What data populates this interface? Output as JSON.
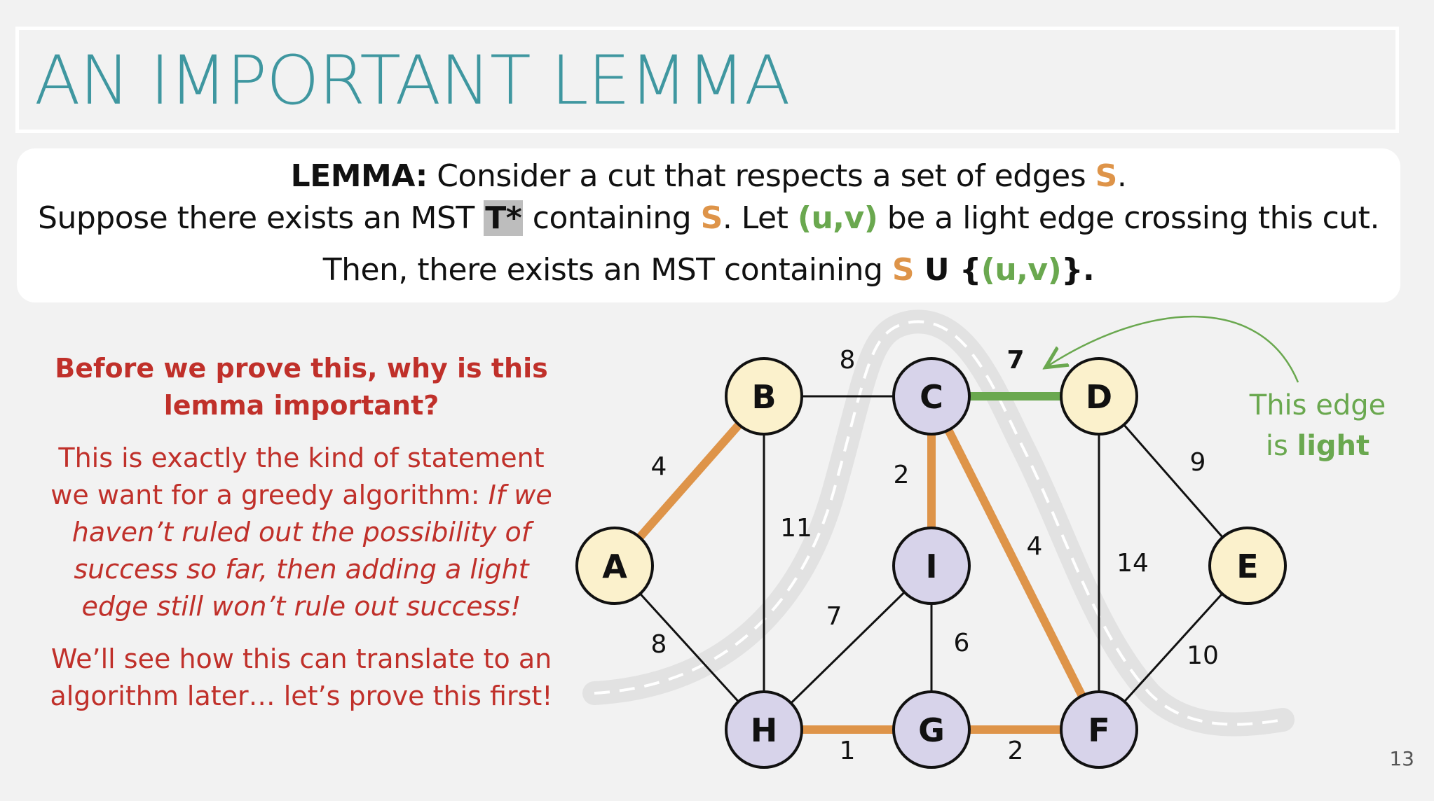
{
  "title": "AN IMPORTANT LEMMA",
  "lemma": {
    "label": "LEMMA:",
    "line1_text": " Consider a cut that respects a set of edges ",
    "S": "S",
    "period": ".",
    "line2_a": "Suppose there exists an MST ",
    "tstar": "T*",
    "line2_b": " containing ",
    "line2_c": ". Let ",
    "uv": "(u,v)",
    "line2_d": " be a light edge crossing this cut.",
    "line3_a": "Then, there exists an MST containing ",
    "union": " U {",
    "close": "}."
  },
  "left": {
    "question": "Before we prove this, why is this lemma important?",
    "p1_normal": "This is exactly the kind of statement we want for a greedy algorithm: ",
    "p1_italic": "If we haven’t ruled out the possibility of success so far, then adding a light edge still won’t rule out success!",
    "p2": "We’ll see how this can translate to an algorithm later… let’s prove this first!"
  },
  "graph": {
    "colors": {
      "yellow_node": "#fbf1cc",
      "purple_node": "#d7d3ea",
      "orange_edge": "#de9449",
      "green_edge": "#6aa84f",
      "cut_line": "#ffffff"
    },
    "nodes": [
      {
        "id": "A",
        "group": "yellow"
      },
      {
        "id": "B",
        "group": "yellow"
      },
      {
        "id": "C",
        "group": "purple"
      },
      {
        "id": "D",
        "group": "yellow"
      },
      {
        "id": "E",
        "group": "yellow"
      },
      {
        "id": "F",
        "group": "purple"
      },
      {
        "id": "G",
        "group": "purple"
      },
      {
        "id": "H",
        "group": "purple"
      },
      {
        "id": "I",
        "group": "purple"
      }
    ],
    "edges": [
      {
        "from": "A",
        "to": "B",
        "weight": "4",
        "style": "orange"
      },
      {
        "from": "A",
        "to": "H",
        "weight": "8",
        "style": "plain"
      },
      {
        "from": "B",
        "to": "C",
        "weight": "8",
        "style": "plain"
      },
      {
        "from": "B",
        "to": "H",
        "weight": "11",
        "style": "plain"
      },
      {
        "from": "C",
        "to": "D",
        "weight": "7",
        "style": "green"
      },
      {
        "from": "C",
        "to": "I",
        "weight": "2",
        "style": "orange"
      },
      {
        "from": "C",
        "to": "F",
        "weight": "4",
        "style": "orange"
      },
      {
        "from": "D",
        "to": "E",
        "weight": "9",
        "style": "plain"
      },
      {
        "from": "D",
        "to": "F",
        "weight": "14",
        "style": "plain"
      },
      {
        "from": "E",
        "to": "F",
        "weight": "10",
        "style": "plain"
      },
      {
        "from": "H",
        "to": "I",
        "weight": "7",
        "style": "plain"
      },
      {
        "from": "I",
        "to": "G",
        "weight": "6",
        "style": "plain"
      },
      {
        "from": "H",
        "to": "G",
        "weight": "1",
        "style": "orange"
      },
      {
        "from": "G",
        "to": "F",
        "weight": "2",
        "style": "orange"
      }
    ],
    "note_line1": "This edge",
    "note_line2_a": "is ",
    "note_line2_b": "light"
  },
  "slide_number": "13"
}
